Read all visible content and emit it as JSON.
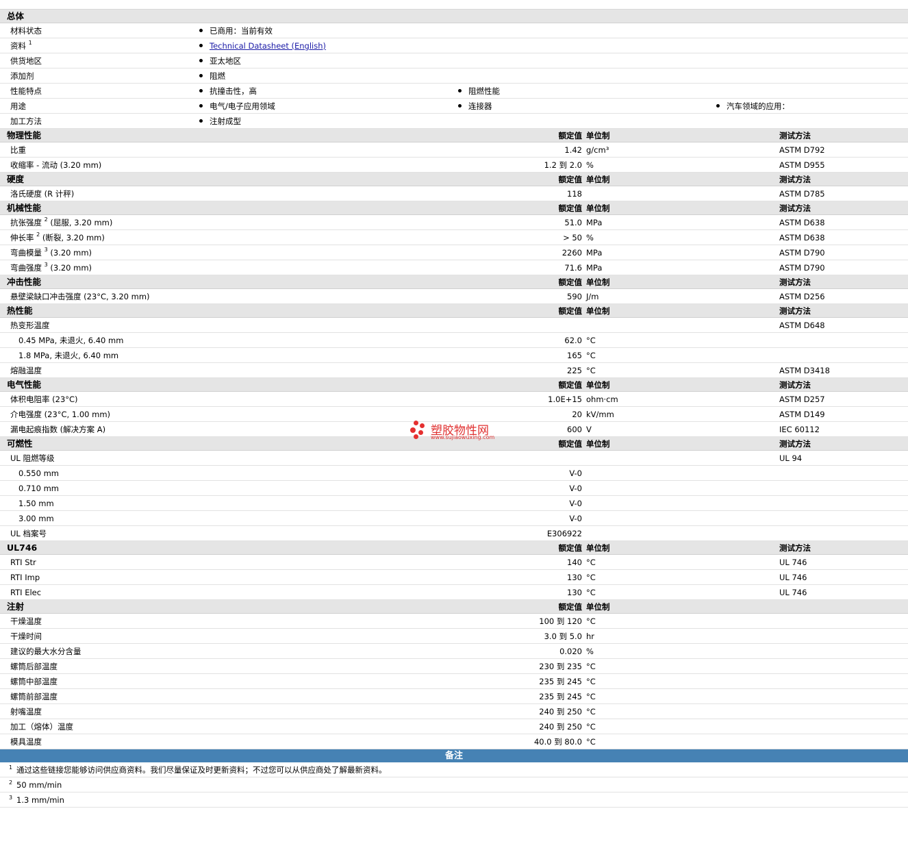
{
  "general": {
    "title": "总体",
    "rows": [
      {
        "label": "材料状态",
        "items": [
          "已商用：当前有效"
        ]
      },
      {
        "label": "资料",
        "sup": "1",
        "items": [],
        "link": "Technical Datasheet (English)"
      },
      {
        "label": "供货地区",
        "items": [
          "亚太地区"
        ]
      },
      {
        "label": "添加剂",
        "items": [
          "阻燃"
        ]
      },
      {
        "label": "性能特点",
        "items": [
          "抗撞击性，高",
          "阻燃性能"
        ]
      },
      {
        "label": "用途",
        "items": [
          "电气/电子应用领域",
          "连接器",
          "汽车领域的应用："
        ]
      },
      {
        "label": "加工方法",
        "items": [
          "注射成型"
        ]
      }
    ]
  },
  "header_labels": {
    "value": "额定值",
    "unit": "单位制",
    "method": "测试方法"
  },
  "physical": {
    "title": "物理性能",
    "rows": [
      {
        "label": "比重",
        "value": "1.42",
        "unit": "g/cm³",
        "method": "ASTM D792"
      },
      {
        "label": "收缩率 - 流动 (3.20 mm)",
        "value": "1.2 到 2.0",
        "unit": "%",
        "method": "ASTM D955"
      }
    ]
  },
  "hardness": {
    "title": "硬度",
    "rows": [
      {
        "label": "洛氏硬度 (R 计秤)",
        "value": "118",
        "unit": "",
        "method": "ASTM D785"
      }
    ]
  },
  "mechanical": {
    "title": "机械性能",
    "rows": [
      {
        "label": "抗张强度",
        "sup": "2",
        "suffix": "(屈服, 3.20 mm)",
        "value": "51.0",
        "unit": "MPa",
        "method": "ASTM D638"
      },
      {
        "label": "伸长率",
        "sup": "2",
        "suffix": "(断裂, 3.20 mm)",
        "value": "> 50",
        "unit": "%",
        "method": "ASTM D638"
      },
      {
        "label": "弯曲模量",
        "sup": "3",
        "suffix": "(3.20 mm)",
        "value": "2260",
        "unit": "MPa",
        "method": "ASTM D790"
      },
      {
        "label": "弯曲强度",
        "sup": "3",
        "suffix": "(3.20 mm)",
        "value": "71.6",
        "unit": "MPa",
        "method": "ASTM D790"
      }
    ]
  },
  "impact": {
    "title": "冲击性能",
    "rows": [
      {
        "label": "悬壁梁缺口冲击强度 (23°C, 3.20 mm)",
        "value": "590",
        "unit": "J/m",
        "method": "ASTM D256"
      }
    ]
  },
  "thermal": {
    "title": "热性能",
    "rows": [
      {
        "label": "热变形温度",
        "value": "",
        "unit": "",
        "method": "ASTM D648"
      },
      {
        "label": "0.45 MPa, 未退火, 6.40 mm",
        "sub": true,
        "value": "62.0",
        "unit": "°C",
        "method": ""
      },
      {
        "label": "1.8 MPa, 未退火, 6.40 mm",
        "sub": true,
        "value": "165",
        "unit": "°C",
        "method": ""
      },
      {
        "label": "熔融温度",
        "value": "225",
        "unit": "°C",
        "method": "ASTM D3418"
      }
    ]
  },
  "electrical": {
    "title": "电气性能",
    "rows": [
      {
        "label": "体积电阻率 (23°C)",
        "value": "1.0E+15",
        "unit": "ohm·cm",
        "method": "ASTM D257"
      },
      {
        "label": "介电强度 (23°C, 1.00 mm)",
        "value": "20",
        "unit": "kV/mm",
        "method": "ASTM D149"
      },
      {
        "label": "漏电起痕指数 (解决方案 A)",
        "value": "600",
        "unit": "V",
        "method": "IEC 60112"
      }
    ]
  },
  "flammability": {
    "title": "可燃性",
    "rows": [
      {
        "label": "UL 阻燃等级",
        "value": "",
        "unit": "",
        "method": "UL 94"
      },
      {
        "label": "0.550 mm",
        "sub": true,
        "value": "V-0",
        "unit": "",
        "method": ""
      },
      {
        "label": "0.710 mm",
        "sub": true,
        "value": "V-0",
        "unit": "",
        "method": ""
      },
      {
        "label": "1.50 mm",
        "sub": true,
        "value": "V-0",
        "unit": "",
        "method": ""
      },
      {
        "label": "3.00 mm",
        "sub": true,
        "value": "V-0",
        "unit": "",
        "method": ""
      },
      {
        "label": "UL 档案号",
        "value": "E306922",
        "unit": "",
        "method": ""
      }
    ]
  },
  "ul746": {
    "title": "UL746",
    "rows": [
      {
        "label": "RTI Str",
        "value": "140",
        "unit": "°C",
        "method": "UL 746"
      },
      {
        "label": "RTI Imp",
        "value": "130",
        "unit": "°C",
        "method": "UL 746"
      },
      {
        "label": "RTI Elec",
        "value": "130",
        "unit": "°C",
        "method": "UL 746"
      }
    ]
  },
  "injection": {
    "title": "注射",
    "rows": [
      {
        "label": "干燥温度",
        "value": "100 到 120",
        "unit": "°C",
        "method": ""
      },
      {
        "label": "干燥时间",
        "value": "3.0 到 5.0",
        "unit": "hr",
        "method": ""
      },
      {
        "label": "建议的最大水分含量",
        "value": "0.020",
        "unit": "%",
        "method": ""
      },
      {
        "label": "螺筒后部温度",
        "value": "230 到 235",
        "unit": "°C",
        "method": ""
      },
      {
        "label": "螺筒中部温度",
        "value": "235 到 245",
        "unit": "°C",
        "method": ""
      },
      {
        "label": "螺筒前部温度",
        "value": "235 到 245",
        "unit": "°C",
        "method": ""
      },
      {
        "label": "射嘴温度",
        "value": "240 到 250",
        "unit": "°C",
        "method": ""
      },
      {
        "label": "加工（熔体）温度",
        "value": "240 到 250",
        "unit": "°C",
        "method": ""
      },
      {
        "label": "模具温度",
        "value": "40.0 到 80.0",
        "unit": "°C",
        "method": ""
      }
    ]
  },
  "notes": {
    "title": "备注",
    "items": [
      {
        "num": "1",
        "text": "通过这些链接您能够访问供应商资料。我们尽量保证及时更新资料；不过您可以从供应商处了解最新资料。"
      },
      {
        "num": "2",
        "text": "50 mm/min"
      },
      {
        "num": "3",
        "text": "1.3 mm/min"
      }
    ]
  },
  "watermark": {
    "text": "塑胶物性网",
    "url": "www.sujiaowuxing.com"
  },
  "colors": {
    "section_bg": "#e5e5e5",
    "notes_bar": "#4682b4",
    "watermark": "#e03030",
    "link": "#1a1aa6"
  }
}
